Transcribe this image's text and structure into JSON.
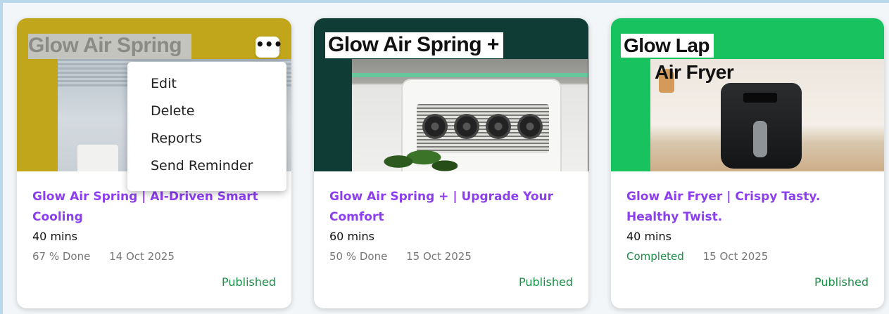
{
  "colors": {
    "title_purple": "#8d3ff0",
    "status_green": "#1b8f46",
    "thumb_mustard": "#c1a61b",
    "thumb_dark_teal": "#103c36",
    "thumb_green": "#18c35f"
  },
  "cards": [
    {
      "thumb_title": "Glow Air Spring",
      "more_icon": "more-horizontal-icon",
      "title": "Glow Air Spring | AI-Driven Smart Cooling",
      "duration": "40 mins",
      "progress": "67 % Done",
      "date": "14 Oct 2025",
      "status": "Published"
    },
    {
      "thumb_title": "Glow Air Spring +",
      "title": "Glow Air Spring + | Upgrade Your Comfort",
      "duration": "60 mins",
      "progress": "50 % Done",
      "date": "15 Oct 2025",
      "status": "Published"
    },
    {
      "thumb_title_line1": "Glow Lap",
      "thumb_title_line2": "Air Fryer",
      "title": "Glow Air Fryer | Crispy Tasty. Healthy Twist.",
      "duration": "40 mins",
      "progress": "Completed",
      "date": "15 Oct 2025",
      "status": "Published"
    }
  ],
  "context_menu": {
    "items": [
      "Edit",
      "Delete",
      "Reports",
      "Send Reminder"
    ]
  }
}
